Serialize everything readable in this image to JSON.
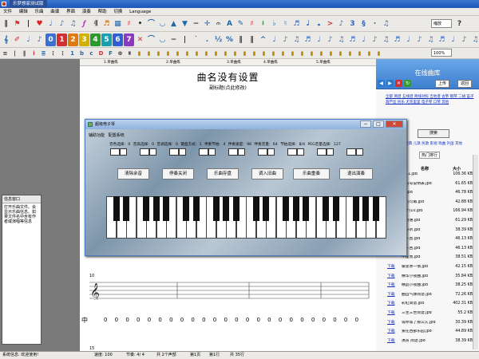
{
  "window": {
    "title": "乐梦想家测试版"
  },
  "menu": [
    "文件",
    "编辑",
    "乐曲",
    "曲谱",
    "界面",
    "演奏",
    "帮助",
    "切换",
    "Language"
  ],
  "toolbar": {
    "zoom_select": "缩放",
    "ratio": "100%"
  },
  "numbers": [
    "0",
    "1",
    "2",
    "3",
    "4",
    "5",
    "6",
    "7"
  ],
  "left": {
    "info_title": "信息窗口",
    "info_text": "打开乐曲文件。会显示乐曲信息。如果文件名中含有作者或演唱等信息"
  },
  "score": {
    "title": "曲名没有设置",
    "subtitle": "副标题(点此修改)",
    "bar_number": "10",
    "bar15": "15",
    "ruler": [
      "1.单曲练",
      "2.单曲练",
      "3.单曲练",
      "4.单曲练",
      "5.单曲练"
    ],
    "notes": "0 0 0 0 0 0 0 0 0 0 0 0 0 0 0 0 0 0 0 0 0 0 0 0",
    "rest_label": "中"
  },
  "library": {
    "title": "在线曲库",
    "up_btn": "上传",
    "back_btn": "返回",
    "links": [
      "全部",
      "简谱",
      "五线谱",
      "简线对照",
      "吉他谱",
      "古筝",
      "钢琴",
      "二胡",
      "笛子",
      "葫芦丝",
      "民乐",
      "尤克里里",
      "电子琴",
      "口琴",
      "其他"
    ],
    "search": "搜索",
    "categories": "分类: 流行 经典 儿歌 民歌 影视 戏曲 外国 其他",
    "hot": "热门排行",
    "col_name": "名称",
    "col_size": "大小",
    "rows": [
      {
        "dl": "",
        "name": "红11.jpd",
        "size": "106.36 KB"
      },
      {
        "dl": "",
        "name": "号符号说明表.jpd",
        "size": "61.65 KB"
      },
      {
        "dl": "",
        "name": "好.jpd",
        "size": "46.78 KB"
      },
      {
        "dl": "",
        "name": "五的可角.jpd",
        "size": "42.88 KB"
      },
      {
        "dl": "",
        "name": "光(F)10.jpd",
        "size": "166.94 KB"
      },
      {
        "dl": "",
        "name": "不为谁.jpd",
        "size": "61.29 KB"
      },
      {
        "dl": "",
        "name": "好好听.jpd",
        "size": "38.39 KB"
      },
      {
        "dl": "",
        "name": "每一回.jpd",
        "size": "46.13 KB"
      },
      {
        "dl": "",
        "name": "每一回.jpd",
        "size": "46.13 KB"
      },
      {
        "dl": "",
        "name": "不是我.jpd",
        "size": "38.51 KB"
      },
      {
        "dl": "下载",
        "name": "被总亲一情.jpd",
        "size": "42.15 KB"
      },
      {
        "dl": "下载",
        "name": "精华小夜曲.jpd",
        "size": "35.84 KB"
      },
      {
        "dl": "下载",
        "name": "精品小夜曲.jpd",
        "size": "38.25 KB"
      },
      {
        "dl": "下载",
        "name": "曲自气球简谱.jpd",
        "size": "72.26 KB"
      },
      {
        "dl": "下载",
        "name": "彩虹简谱.jpd",
        "size": "402.31 KB"
      },
      {
        "dl": "下载",
        "name": "三生三世简谱.jpd",
        "size": "55.2 KB"
      },
      {
        "dl": "下载",
        "name": "等你等了那么久.jpd",
        "size": "30.39 KB"
      },
      {
        "dl": "下载",
        "name": "爱在西部乐园.jpd",
        "size": "44.89 KB"
      },
      {
        "dl": "下载",
        "name": "演员 简谱.jpd",
        "size": "38.39 KB"
      }
    ]
  },
  "dialog": {
    "title": "超级电子琴",
    "menu": "辅助功能  配置系统",
    "params": "音色选择: 0   音高选择: 0   音调选择: 0   键盘方式: 1   伴奏节拍: 4   伴奏速度: 96   伴奏音量: 64   节拍选择: 8/4   PEG音量选择: 127",
    "buttons": [
      "清除余音",
      "停奏关闭",
      "乐曲存盘",
      "调入旧曲",
      "乐曲重奏",
      "退出演奏"
    ]
  },
  "status": {
    "system": "系统信息: 欢迎使用!",
    "speed": "速度: 100",
    "beat": "节奏: 4/ 4",
    "voices": "共 2个声部",
    "page": "第1页",
    "line": "第1行",
    "bars": "共 35行"
  }
}
